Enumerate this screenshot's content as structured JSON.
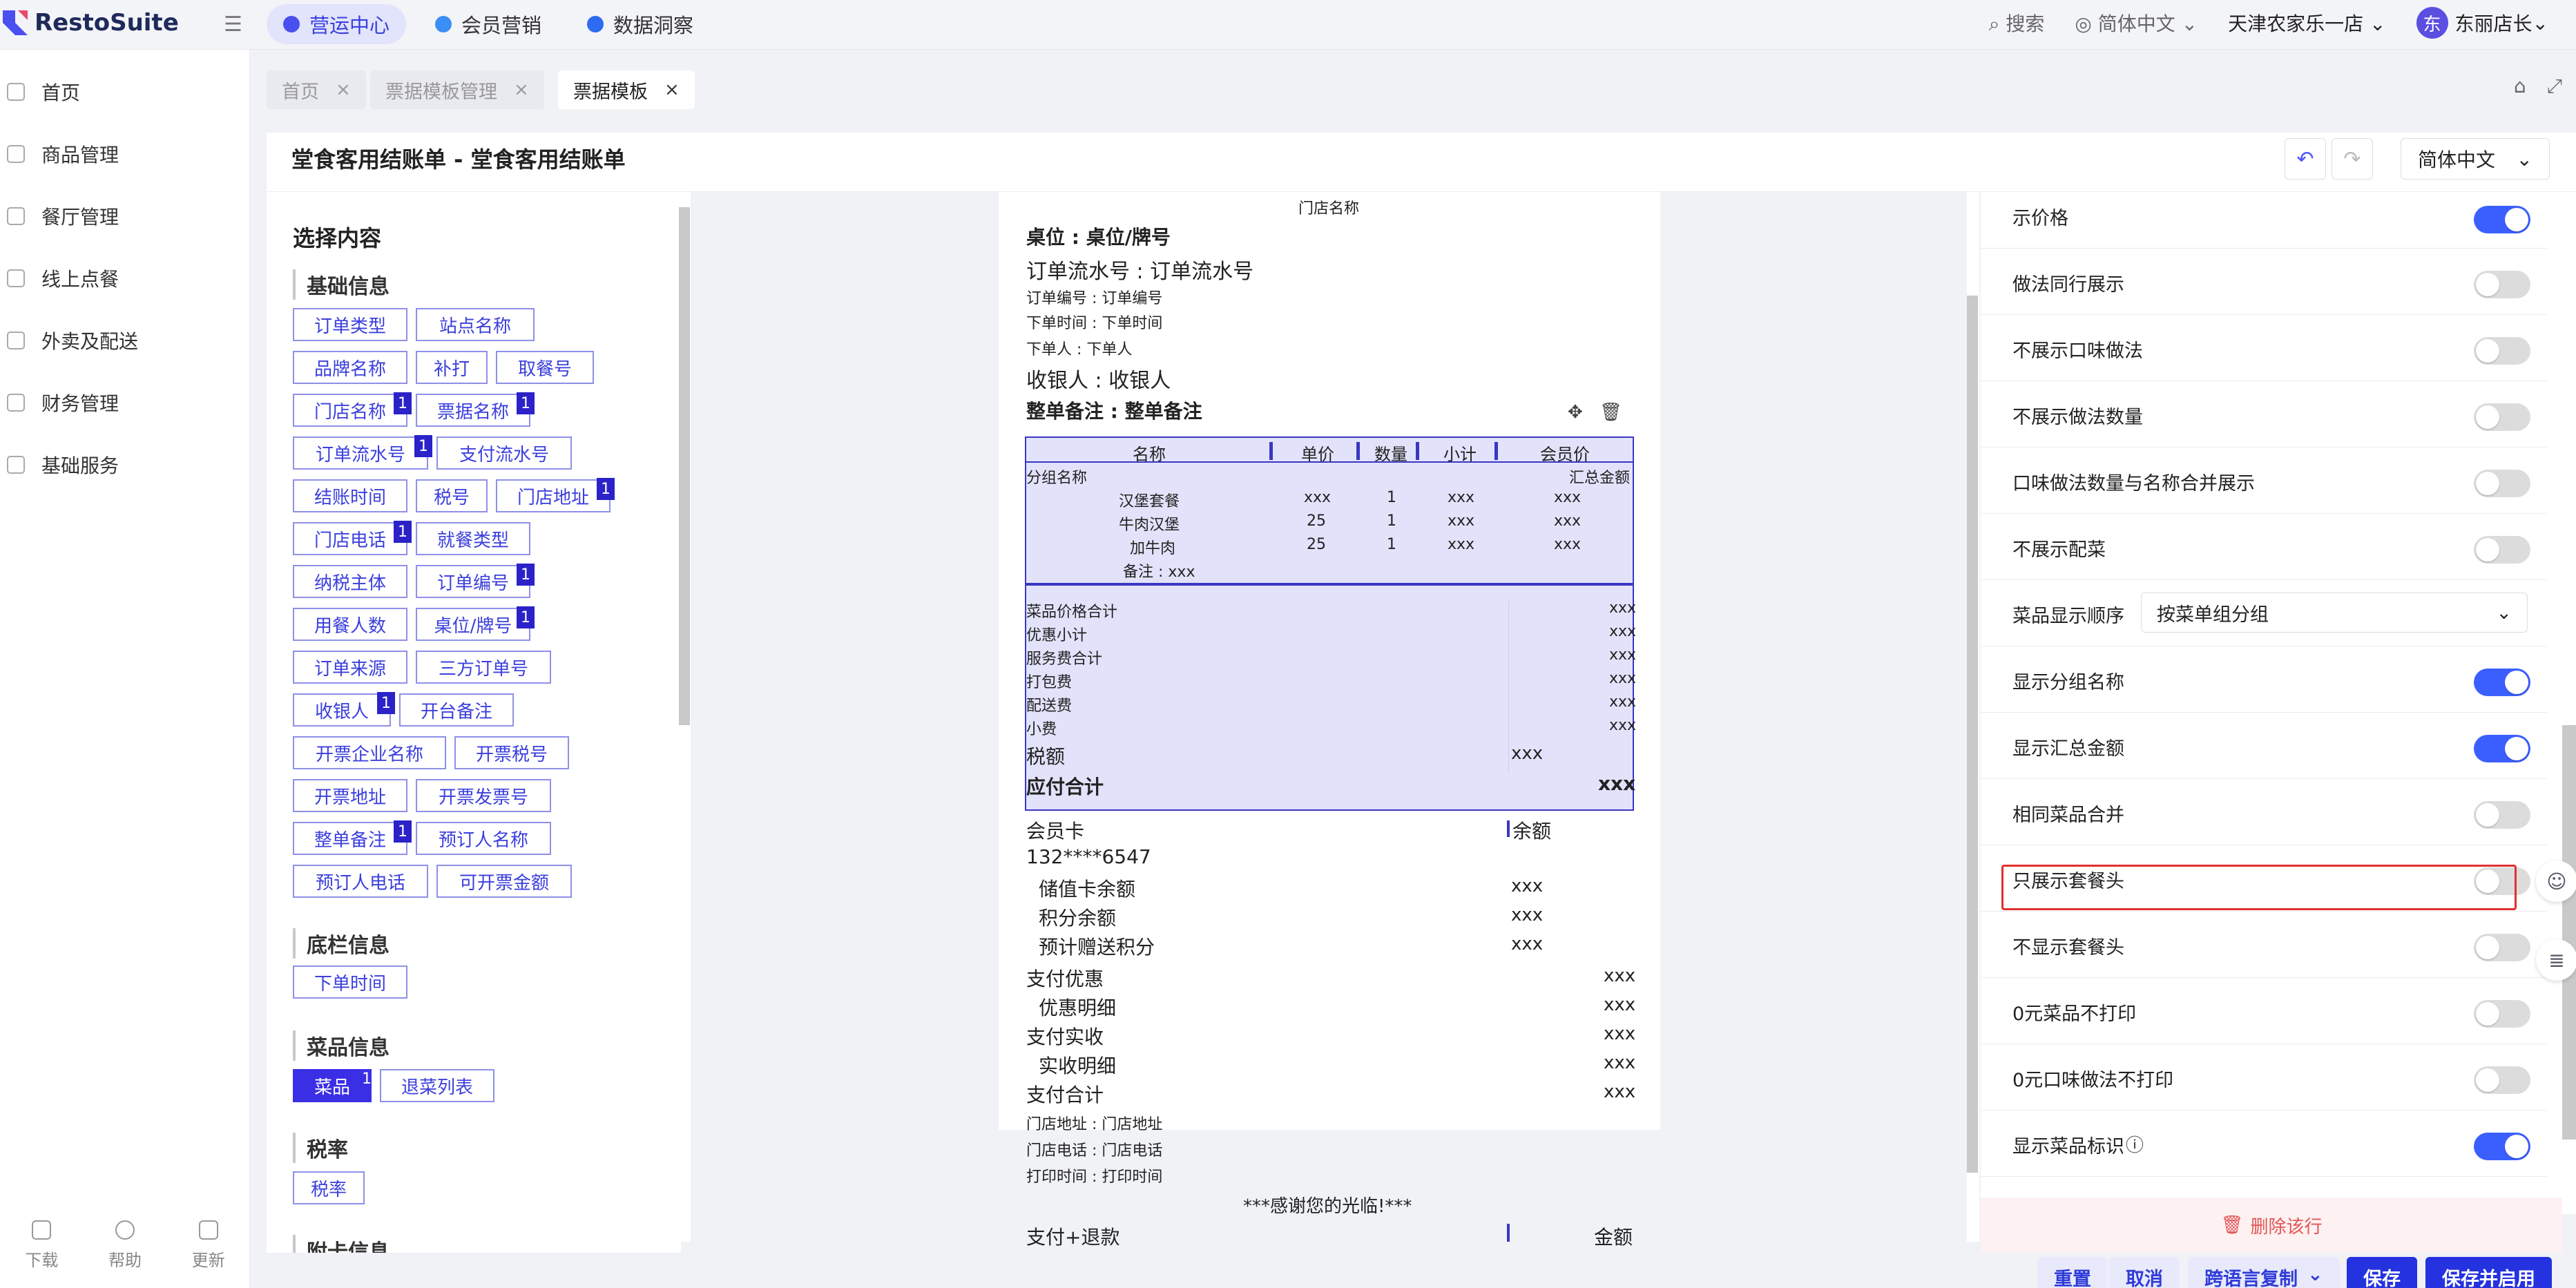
{
  "app": {
    "logo": "RestoSuite"
  },
  "topnav": [
    {
      "label": "营运中心",
      "active": true,
      "color": "#4a4ff0"
    },
    {
      "label": "会员营销",
      "active": false,
      "color": "#3b8ef5"
    },
    {
      "label": "数据洞察",
      "active": false,
      "color": "#2e6bf0"
    }
  ],
  "topright": {
    "search": "搜索",
    "language": "简体中文",
    "store": "天津农家乐一店",
    "avatar_initial": "东",
    "user": "东丽店长"
  },
  "sidebar": {
    "items": [
      "首页",
      "商品管理",
      "餐厅管理",
      "线上点餐",
      "外卖及配送",
      "财务管理",
      "基础服务"
    ],
    "bottom": [
      "下载",
      "帮助",
      "更新"
    ]
  },
  "tabs": [
    {
      "label": "首页",
      "active": false
    },
    {
      "label": "票据模板管理",
      "active": false
    },
    {
      "label": "票据模板",
      "active": true
    }
  ],
  "page": {
    "title": "堂食客用结账单 - 堂食客用结账单",
    "language": "简体中文"
  },
  "left": {
    "title": "选择内容",
    "sections": {
      "basic": "基础信息",
      "footer": "底栏信息",
      "dish": "菜品信息",
      "tax": "税率",
      "appendix": "附卡信息"
    },
    "chips": {
      "order_type": "订单类型",
      "station": "站点名称",
      "brand": "品牌名称",
      "reprint": "补打",
      "pickup": "取餐号",
      "store_name": "门店名称",
      "receipt_name": "票据名称",
      "order_serial": "订单流水号",
      "pay_serial": "支付流水号",
      "checkout_time": "结账时间",
      "tax_no": "税号",
      "store_addr": "门店地址",
      "store_phone": "门店电话",
      "dining_type": "就餐类型",
      "tax_subject": "纳税主体",
      "order_no": "订单编号",
      "diners": "用餐人数",
      "table": "桌位/牌号",
      "order_source": "订单来源",
      "third_order": "三方订单号",
      "cashier": "收银人",
      "open_note": "开台备注",
      "invoice_company": "开票企业名称",
      "invoice_tax": "开票税号",
      "invoice_addr": "开票地址",
      "invoice_no": "开票发票号",
      "order_note": "整单备注",
      "reserver": "预订人名称",
      "reserver_phone": "预订人电话",
      "invoice_amount": "可开票金额",
      "order_time": "下单时间",
      "dishes": "菜品",
      "refund_list": "退菜列表",
      "tax_rate": "税率"
    },
    "badge": "1"
  },
  "receipt": {
    "store_name": "门店名称",
    "table": "桌位 : 桌位/牌号",
    "serial": "订单流水号 : 订单流水号",
    "order_no": "订单编号 : 订单编号",
    "order_time": "下单时间 : 下单时间",
    "orderer": "下单人 : 下单人",
    "cashier": "收银人 : 收银人",
    "note": "整单备注 : 整单备注",
    "cols": [
      "名称",
      "单价",
      "数量",
      "小计",
      "会员价"
    ],
    "group_name": "分组名称",
    "group_total": "汇总金额",
    "items": [
      {
        "name": "汉堡套餐",
        "price": "xxx",
        "qty": "1",
        "sub": "xxx",
        "member": "xxx"
      },
      {
        "name": "牛肉汉堡",
        "price": "25",
        "qty": "1",
        "sub": "xxx",
        "member": "xxx"
      },
      {
        "name": "加牛肉",
        "price": "25",
        "qty": "1",
        "sub": "xxx",
        "member": "xxx"
      }
    ],
    "item_note": "备注 : xxx",
    "sums": [
      {
        "label": "菜品价格合计",
        "value": "xxx"
      },
      {
        "label": "优惠小计",
        "value": "xxx"
      },
      {
        "label": "服务费合计",
        "value": "xxx"
      },
      {
        "label": "打包费",
        "value": "xxx"
      },
      {
        "label": "配送费",
        "value": "xxx"
      },
      {
        "label": "小费",
        "value": "xxx"
      }
    ],
    "tax_label": "税额",
    "tax_value": "xxx",
    "due_label": "应付合计",
    "due_value": "xxx",
    "member_card": "会员卡",
    "balance": "余额",
    "phone": "132****6547",
    "member_rows": [
      {
        "label": "储值卡余额",
        "value": "xxx"
      },
      {
        "label": "积分余额",
        "value": "xxx"
      },
      {
        "label": "预计赠送积分",
        "value": "xxx"
      }
    ],
    "pay_rows": [
      {
        "label": "支付优惠",
        "value": "xxx",
        "indent": false
      },
      {
        "label": "优惠明细",
        "value": "xxx",
        "indent": true
      },
      {
        "label": "支付实收",
        "value": "xxx",
        "indent": false
      },
      {
        "label": "实收明细",
        "value": "xxx",
        "indent": true
      },
      {
        "label": "支付合计",
        "value": "xxx",
        "indent": false
      }
    ],
    "addr": "门店地址 : 门店地址",
    "store_phone": "门店电话 : 门店电话",
    "print_time": "打印时间 : 打印时间",
    "thanks": "***感谢您的光临!***",
    "pay_refund": "支付+退款",
    "amount": "金额"
  },
  "right": {
    "rows": [
      {
        "label": "示价格",
        "on": true
      },
      {
        "label": "做法同行展示",
        "on": false
      },
      {
        "label": "不展示口味做法",
        "on": false
      },
      {
        "label": "不展示做法数量",
        "on": false
      },
      {
        "label": "口味做法数量与名称合并展示",
        "on": false
      },
      {
        "label": "不展示配菜",
        "on": false
      },
      {
        "label": "菜品显示顺序",
        "select": "按菜单组分组"
      },
      {
        "label": "显示分组名称",
        "on": true
      },
      {
        "label": "显示汇总金额",
        "on": true
      },
      {
        "label": "相同菜品合并",
        "on": false
      },
      {
        "label": "只展示套餐头",
        "on": false
      },
      {
        "label": "不显示套餐头",
        "on": false
      },
      {
        "label": "0元菜品不打印",
        "on": false
      },
      {
        "label": "0元口味做法不打印",
        "on": false
      },
      {
        "label": "显示菜品标识",
        "on": true
      }
    ],
    "delete_row": "删除该行"
  },
  "bottom": {
    "reset": "重置",
    "cancel": "取消",
    "translate": "跨语言复制",
    "save": "保存",
    "save_enable": "保存并启用"
  },
  "colors": {
    "accent": "#3b3fdc",
    "highlight": "#e0312f",
    "toggle_on": "#3b5fff"
  }
}
